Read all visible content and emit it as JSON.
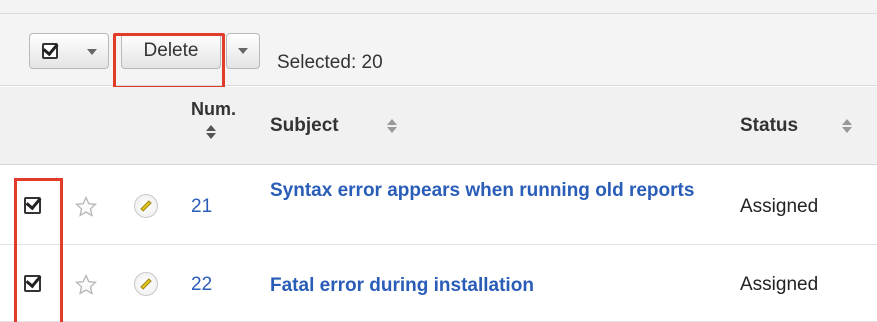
{
  "toolbar": {
    "delete_label": "Delete",
    "selected_text": "Selected: 20"
  },
  "table": {
    "columns": {
      "num": "Num.",
      "subject": "Subject",
      "status": "Status"
    },
    "rows": [
      {
        "num": "21",
        "subject": "Syntax error appears when running old reports",
        "status": "Assigned",
        "checked": true
      },
      {
        "num": "22",
        "subject": "Fatal error during installation",
        "status": "Assigned",
        "checked": true
      }
    ]
  },
  "colors": {
    "link": "#2a5db8",
    "highlight": "#e23b2a",
    "header_bg": "#f1f1f1"
  },
  "icons": [
    "checkbox-icon",
    "chevron-down-icon",
    "sort-icon",
    "star-icon",
    "pencil-icon"
  ]
}
